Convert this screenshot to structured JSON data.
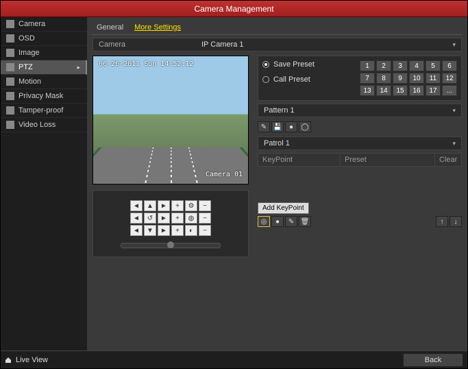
{
  "title": "Camera Management",
  "sidebar": {
    "items": [
      {
        "label": "Camera",
        "icon": "camera-icon"
      },
      {
        "label": "OSD",
        "icon": "osd-icon"
      },
      {
        "label": "Image",
        "icon": "image-icon"
      },
      {
        "label": "PTZ",
        "icon": "ptz-icon",
        "active": true
      },
      {
        "label": "Motion",
        "icon": "motion-icon"
      },
      {
        "label": "Privacy Mask",
        "icon": "privacy-icon"
      },
      {
        "label": "Tamper-proof",
        "icon": "tamper-icon"
      },
      {
        "label": "Video Loss",
        "icon": "loss-icon"
      }
    ]
  },
  "tabs": {
    "general": "General",
    "more": "More Settings"
  },
  "camera_row": {
    "label": "Camera",
    "value": "IP Camera 1"
  },
  "preview": {
    "timestamp": "06-26-2011 Sun 14:52:12",
    "camera_name": "Camera 01"
  },
  "preset": {
    "save_label": "Save Preset",
    "call_label": "Call Preset",
    "numbers": [
      "1",
      "2",
      "3",
      "4",
      "5",
      "6",
      "7",
      "8",
      "9",
      "10",
      "11",
      "12",
      "13",
      "14",
      "15",
      "16",
      "17",
      "..."
    ]
  },
  "pattern": {
    "title": "Pattern 1"
  },
  "patrol": {
    "title": "Patrol 1",
    "col1": "KeyPoint",
    "col2": "Preset",
    "col3": "Clear",
    "tooltip": "Add KeyPoint"
  },
  "ptz_btns": [
    "◄",
    "▲",
    "►",
    "+",
    "⚙",
    "−",
    "◄",
    "↺",
    "►",
    "+",
    "◍",
    "−",
    "◄",
    "▼",
    "►",
    "+",
    "◐",
    "−"
  ],
  "pattern_tools": [
    "✎",
    "💾",
    "●",
    "◯"
  ],
  "patrol_tools_left": [
    "◎",
    "●",
    "✎",
    "🗑"
  ],
  "patrol_tools_right": [
    "↑",
    "↓"
  ],
  "footer": {
    "live_view": "Live View",
    "back": "Back"
  }
}
